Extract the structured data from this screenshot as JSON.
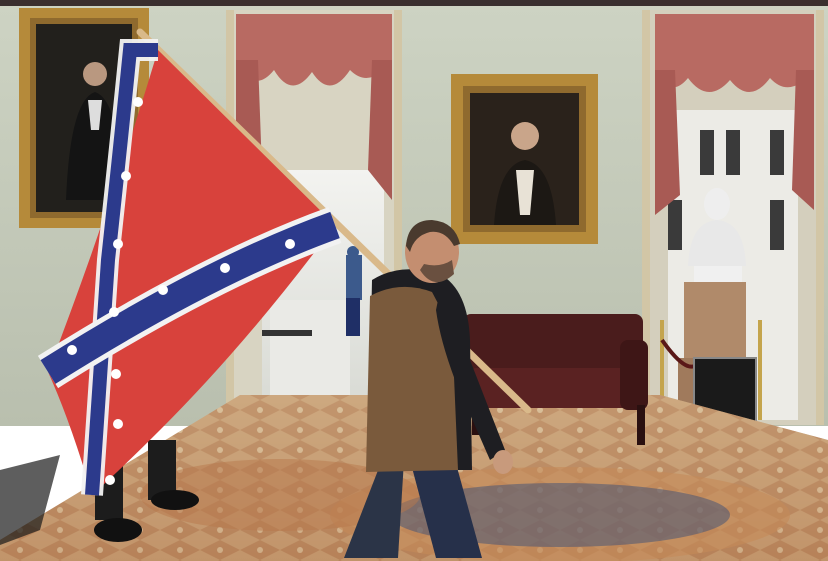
{
  "image": {
    "kind": "photograph",
    "description_visible_text": []
  },
  "colors": {
    "wall": "#c9cfc0",
    "wall_shadow": "#aeb4a3",
    "frame_gold": "#b58a3a",
    "drapery": "#b86a62",
    "flag_red": "#d8423c",
    "flag_blue": "#2c3a8c",
    "floor_tan": "#c9a57a",
    "sofa": "#4a1c1c",
    "vest": "#7a5a3c",
    "hoodie": "#1e1e22",
    "jeans": "#2b3447",
    "bust": "#eeeeee",
    "top_border": "#3a2f2f"
  }
}
